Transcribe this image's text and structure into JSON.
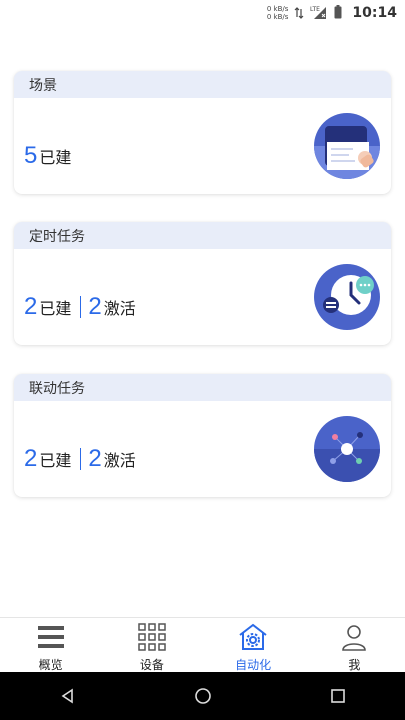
{
  "status_bar": {
    "net_up": "0 kB/s",
    "net_down": "0 kB/s",
    "network_type": "LTE",
    "time": "10:14"
  },
  "cards": {
    "scene": {
      "title": "场景",
      "created_count": "5",
      "created_label": "已建",
      "icon": "phone-card-icon"
    },
    "timer": {
      "title": "定时任务",
      "created_count": "2",
      "created_label": "已建",
      "active_count": "2",
      "active_label": "激活",
      "icon": "clock-icon"
    },
    "linkage": {
      "title": "联动任务",
      "created_count": "2",
      "created_label": "已建",
      "active_count": "2",
      "active_label": "激活",
      "icon": "network-nodes-icon"
    }
  },
  "tabs": [
    {
      "label": "概览",
      "icon": "list-icon",
      "active": false
    },
    {
      "label": "设备",
      "icon": "grid-icon",
      "active": false
    },
    {
      "label": "自动化",
      "icon": "home-gear-icon",
      "active": true
    },
    {
      "label": "我",
      "icon": "person-icon",
      "active": false
    }
  ],
  "colors": {
    "accent": "#2b6ae8",
    "card_header": "#e8edf9",
    "illustration": "#4a63c9"
  }
}
